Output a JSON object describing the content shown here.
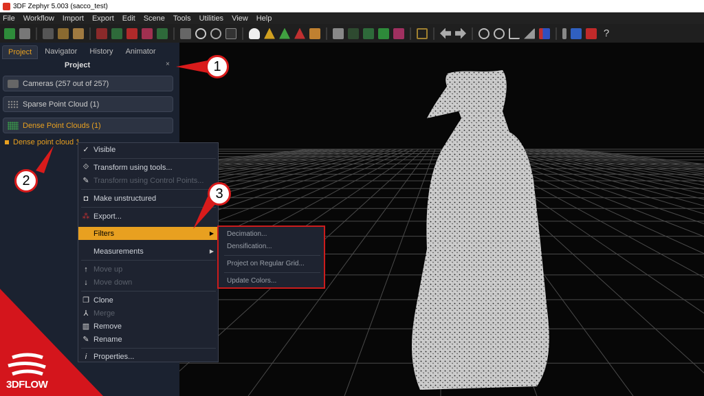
{
  "window": {
    "title": "3DF Zephyr 5.003 (sacco_test)"
  },
  "menu": [
    "File",
    "Workflow",
    "Import",
    "Export",
    "Edit",
    "Scene",
    "Tools",
    "Utilities",
    "View",
    "Help"
  ],
  "toolbar": {
    "accent_red": "#d32f2f",
    "accent_orange": "#e8a020"
  },
  "panel": {
    "tabs": [
      "Project",
      "Navigator",
      "History",
      "Animator"
    ],
    "active_tab": "Project",
    "title": "Project",
    "close_glyph": "×",
    "cameras_label": "Cameras (257 out of 257)",
    "sparse_label": "Sparse Point Cloud (1)",
    "dense_label": "Dense Point Clouds (1)",
    "tree_item": "Dense point cloud 1"
  },
  "context_menu": {
    "items": [
      {
        "label": "Visible",
        "icon": "check-icon",
        "state": "normal"
      },
      {
        "label": "Transform using tools...",
        "icon": "transform-icon",
        "state": "normal"
      },
      {
        "label": "Transform using Control Points...",
        "icon": "control-points-icon",
        "state": "disabled"
      },
      {
        "label": "Make unstructured",
        "icon": "camera-icon",
        "state": "normal"
      },
      {
        "label": "Export...",
        "icon": "export-icon",
        "state": "normal"
      },
      {
        "label": "Filters",
        "icon": "",
        "state": "highlighted"
      },
      {
        "label": "Measurements",
        "icon": "",
        "state": "normal"
      },
      {
        "label": "Move up",
        "icon": "arrow-up-icon",
        "state": "disabled"
      },
      {
        "label": "Move down",
        "icon": "arrow-down-icon",
        "state": "disabled"
      },
      {
        "label": "Clone",
        "icon": "clone-icon",
        "state": "normal"
      },
      {
        "label": "Merge",
        "icon": "merge-icon",
        "state": "disabled"
      },
      {
        "label": "Remove",
        "icon": "trash-icon",
        "state": "normal"
      },
      {
        "label": "Rename",
        "icon": "pencil-icon",
        "state": "normal"
      },
      {
        "label": "Properties...",
        "icon": "info-icon",
        "state": "normal"
      }
    ],
    "submenu_glyph": "▶"
  },
  "filters_submenu": {
    "items": [
      "Decimation...",
      "Densification...",
      "Project on Regular Grid...",
      "Update Colors..."
    ]
  },
  "callouts": [
    "1",
    "2",
    "3"
  ],
  "brand": {
    "text": "3DFLOW"
  }
}
